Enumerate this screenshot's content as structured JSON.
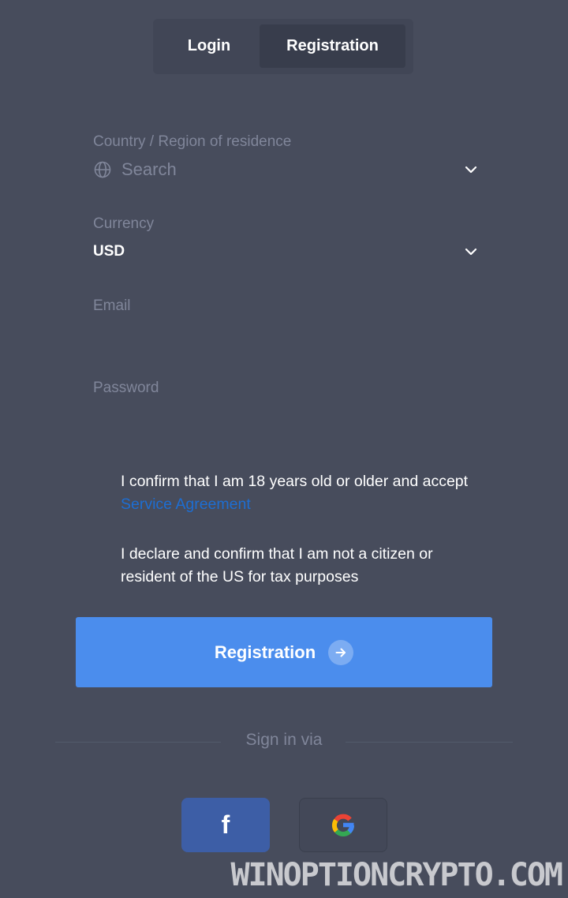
{
  "tabs": [
    {
      "label": "Login",
      "active": false
    },
    {
      "label": "Registration",
      "active": true
    }
  ],
  "form": {
    "country": {
      "label": "Country / Region of residence",
      "placeholder": "Search",
      "icon": "globe-icon"
    },
    "currency": {
      "label": "Currency",
      "value": "USD"
    },
    "email": {
      "label": "Email",
      "value": ""
    },
    "password": {
      "label": "Password",
      "value": ""
    }
  },
  "agreements": {
    "age_text": "I confirm that I am 18 years old or older and accept",
    "age_link": "Service Agreement",
    "tax_text": "I declare and confirm that I am not a citizen or resident of the US for tax purposes"
  },
  "submit": {
    "label": "Registration",
    "icon": "arrow-right-icon"
  },
  "social": {
    "heading": "Sign in via",
    "buttons": [
      {
        "name": "facebook",
        "glyph": "f",
        "icon": "facebook-icon"
      },
      {
        "name": "google",
        "icon": "google-icon"
      }
    ]
  },
  "watermark": "WINOPTIONCRYPTO.COM",
  "colors": {
    "background": "#474c5c",
    "primary_button": "#4b8ded",
    "link": "#1d6ed3",
    "facebook": "#3d5ea6",
    "muted_text": "#80869a"
  }
}
